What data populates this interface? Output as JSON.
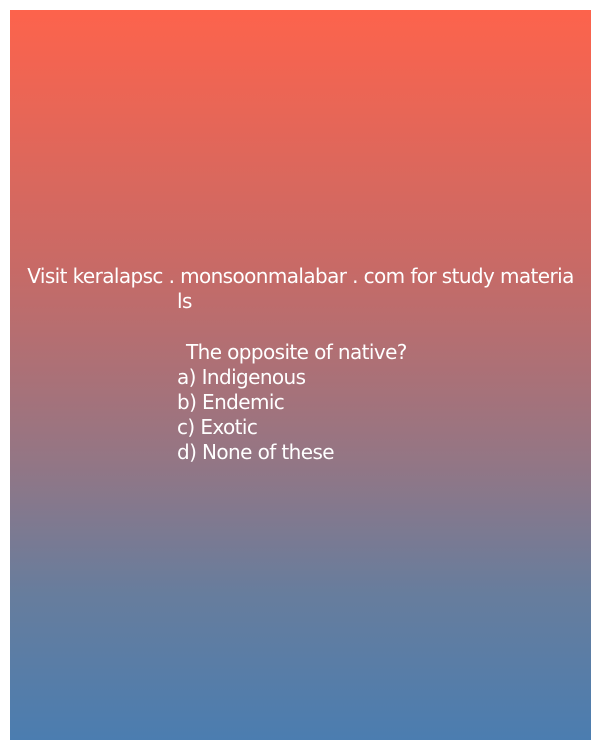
{
  "promo": {
    "line1": "Visit keralapsc . monsoonmalabar . com for study materia",
    "line2": "ls"
  },
  "question": {
    "text": "The opposite of native?",
    "options": [
      "a) Indigenous",
      "b) Endemic",
      "c) Exotic",
      "d) None of these"
    ]
  },
  "colors": {
    "gradient_top": "#fd634c",
    "gradient_bottom": "#4b7db0",
    "text": "#ffffff"
  }
}
